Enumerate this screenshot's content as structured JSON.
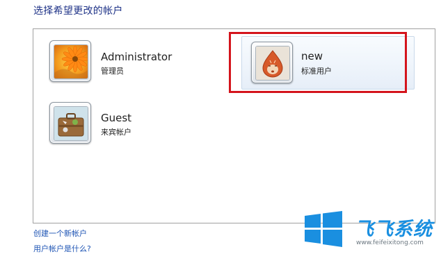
{
  "page": {
    "heading": "选择希望更改的帐户"
  },
  "accounts": [
    {
      "name": "Administrator",
      "role": "管理员",
      "avatar": "flower-avatar-icon"
    },
    {
      "name": "new",
      "role": "标准用户",
      "avatar": "cartoon-drop-avatar-icon"
    },
    {
      "name": "Guest",
      "role": "来宾帐户",
      "avatar": "suitcase-avatar-icon"
    }
  ],
  "links": {
    "create_account": "创建一个新帐户",
    "what_is_account": "用户帐户是什么?"
  },
  "watermark": {
    "title": "飞飞系统",
    "url": "www.feifeixitong.com"
  },
  "colors": {
    "heading": "#1e3287",
    "link": "#1e54b4",
    "highlight": "#d4141c",
    "watermark": "#1a8fe0"
  }
}
